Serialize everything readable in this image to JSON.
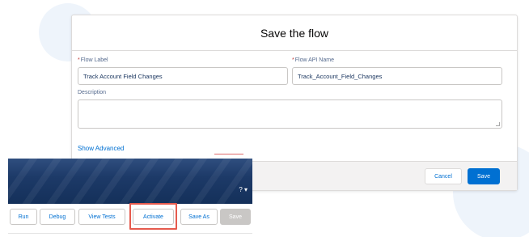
{
  "colors": {
    "brand_blue": "#0070d2",
    "header_navy": "#1d3a68",
    "highlight_red": "#e65a4d",
    "required_red": "#c23934"
  },
  "modal": {
    "title": "Save the flow",
    "flow_label": {
      "label": "Flow Label",
      "required_marker": "*",
      "value": "Track Account Field Changes"
    },
    "flow_api_name": {
      "label": "Flow API Name",
      "required_marker": "*",
      "value": "Track_Account_Field_Changes"
    },
    "description": {
      "label": "Description",
      "value": ""
    },
    "show_advanced_link": "Show Advanced",
    "cancel_button": "Cancel",
    "save_button": "Save"
  },
  "toolbar": {
    "help_label": "? ▾",
    "buttons": {
      "run": "Run",
      "debug": "Debug",
      "view_tests": "View Tests",
      "activate": "Activate",
      "save_as": "Save As",
      "save": "Save"
    }
  }
}
